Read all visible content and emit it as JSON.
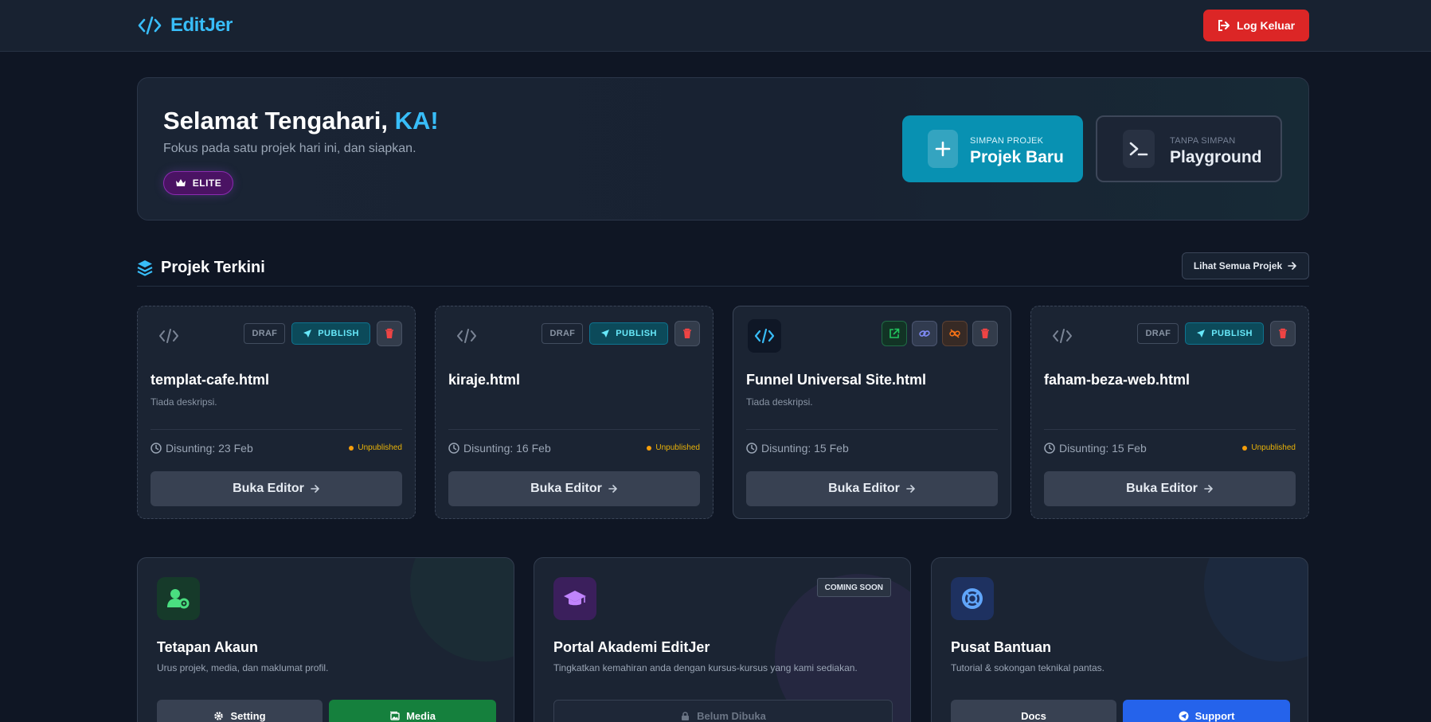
{
  "header": {
    "brand": "EditJer",
    "logout_label": "Log Keluar"
  },
  "hero": {
    "greeting": "Selamat Tengahari,",
    "user": "KA!",
    "subtitle": "Fokus pada satu projek hari ini, dan siapkan.",
    "badge": "ELITE",
    "new_project": {
      "small": "SIMPAN PROJEK",
      "big": "Projek Baru"
    },
    "playground": {
      "small": "TANPA SIMPAN",
      "big": "Playground"
    }
  },
  "recent": {
    "title": "Projek Terkini",
    "see_all": "Lihat Semua Projek",
    "projects": [
      {
        "name": "templat-cafe.html",
        "desc": "Tiada deskripsi.",
        "edited": "Disunting: 23 Feb",
        "status": "Unpublished",
        "draft_label": "DRAF",
        "publish_label": "PUBLISH",
        "open_label": "Buka Editor"
      },
      {
        "name": "kiraje.html",
        "desc": "",
        "edited": "Disunting: 16 Feb",
        "status": "Unpublished",
        "draft_label": "DRAF",
        "publish_label": "PUBLISH",
        "open_label": "Buka Editor"
      },
      {
        "name": "Funnel Universal Site.html",
        "desc": "Tiada deskripsi.",
        "edited": "Disunting: 15 Feb",
        "status": "",
        "open_label": "Buka Editor"
      },
      {
        "name": "faham-beza-web.html",
        "desc": "",
        "edited": "Disunting: 15 Feb",
        "status": "Unpublished",
        "draft_label": "DRAF",
        "publish_label": "PUBLISH",
        "open_label": "Buka Editor"
      }
    ]
  },
  "features": {
    "account": {
      "title": "Tetapan Akaun",
      "desc": "Urus projek, media, dan maklumat profil.",
      "btn_setting": "Setting",
      "btn_media": "Media"
    },
    "academy": {
      "title": "Portal Akademi EditJer",
      "desc": "Tingkatkan kemahiran anda dengan kursus-kursus yang kami sediakan.",
      "badge": "COMING SOON",
      "btn_locked": "Belum Dibuka"
    },
    "help": {
      "title": "Pusat Bantuan",
      "desc": "Tutorial & sokongan teknikal pantas.",
      "btn_docs": "Docs",
      "btn_support": "Support"
    }
  },
  "colors": {
    "accent": "#38bdf8",
    "primary_button": "#0891b2",
    "danger": "#dc2626",
    "success": "#15803d",
    "support": "#2563eb",
    "warning": "#f59e0b"
  }
}
